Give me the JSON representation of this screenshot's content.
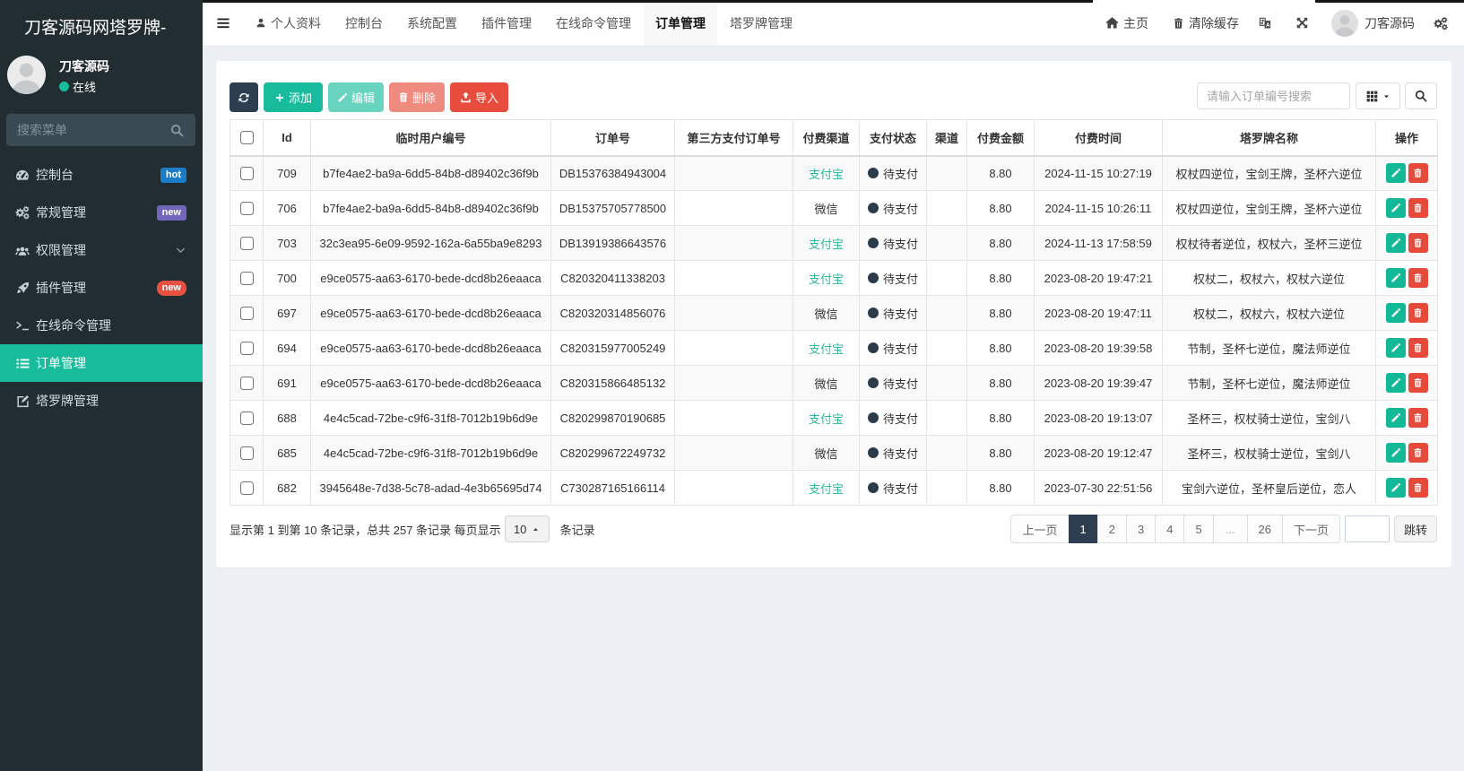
{
  "sidebar": {
    "logo": "刀客源码网塔罗牌-",
    "user": {
      "name": "刀客源码",
      "status": "在线"
    },
    "search_placeholder": "搜索菜单",
    "menu": [
      {
        "label": "控制台",
        "icon": "tachometer-icon",
        "badge": "hot",
        "badge_color": "#1b7cc8",
        "badge_shape": "rect"
      },
      {
        "label": "常规管理",
        "icon": "cogs-icon",
        "badge": "new",
        "badge_color": "#7266ba",
        "badge_shape": "rect"
      },
      {
        "label": "权限管理",
        "icon": "users-icon",
        "chevron": true
      },
      {
        "label": "插件管理",
        "icon": "rocket-icon",
        "badge": "new",
        "badge_color": "#e8503f",
        "badge_shape": "pill"
      },
      {
        "label": "在线命令管理",
        "icon": "terminal-icon"
      },
      {
        "label": "订单管理",
        "icon": "list-icon",
        "active": true
      },
      {
        "label": "塔罗牌管理",
        "icon": "file-edit-icon"
      }
    ]
  },
  "topnav": {
    "tabs": [
      {
        "label": "个人资料",
        "icon": "user-icon"
      },
      {
        "label": "控制台"
      },
      {
        "label": "系统配置"
      },
      {
        "label": "插件管理"
      },
      {
        "label": "在线命令管理"
      },
      {
        "label": "订单管理",
        "active": true
      },
      {
        "label": "塔罗牌管理"
      }
    ],
    "right": {
      "home_label": "主页",
      "clear_cache_label": "清除缓存",
      "username": "刀客源码"
    }
  },
  "toolbar": {
    "add_label": "添加",
    "edit_label": "编辑",
    "delete_label": "删除",
    "import_label": "导入",
    "search_placeholder": "请输入订单编号搜索"
  },
  "table": {
    "columns": [
      "Id",
      "临时用户编号",
      "订单号",
      "第三方支付订单号",
      "付费渠道",
      "支付状态",
      "渠道",
      "付费金额",
      "付费时间",
      "塔罗牌名称",
      "操作"
    ],
    "rows": [
      {
        "id": "709",
        "user_no": "b7fe4ae2-ba9a-6dd5-84b8-d89402c36f9b",
        "order_no": "DB15376384943004",
        "third_no": "",
        "pay_channel": "支付宝",
        "pay_status": "待支付",
        "channel": "",
        "amount": "8.80",
        "pay_time": "2024-11-15 10:27:19",
        "tarot": "权杖四逆位，宝剑王牌，圣杯六逆位"
      },
      {
        "id": "706",
        "user_no": "b7fe4ae2-ba9a-6dd5-84b8-d89402c36f9b",
        "order_no": "DB15375705778500",
        "third_no": "",
        "pay_channel": "微信",
        "pay_status": "待支付",
        "channel": "",
        "amount": "8.80",
        "pay_time": "2024-11-15 10:26:11",
        "tarot": "权杖四逆位，宝剑王牌，圣杯六逆位"
      },
      {
        "id": "703",
        "user_no": "32c3ea95-6e09-9592-162a-6a55ba9e8293",
        "order_no": "DB13919386643576",
        "third_no": "",
        "pay_channel": "支付宝",
        "pay_status": "待支付",
        "channel": "",
        "amount": "8.80",
        "pay_time": "2024-11-13 17:58:59",
        "tarot": "权杖待者逆位，权杖六，圣杯三逆位"
      },
      {
        "id": "700",
        "user_no": "e9ce0575-aa63-6170-bede-dcd8b26eaaca",
        "order_no": "C820320411338203",
        "third_no": "",
        "pay_channel": "支付宝",
        "pay_status": "待支付",
        "channel": "",
        "amount": "8.80",
        "pay_time": "2023-08-20 19:47:21",
        "tarot": "权杖二，权杖六，权杖六逆位"
      },
      {
        "id": "697",
        "user_no": "e9ce0575-aa63-6170-bede-dcd8b26eaaca",
        "order_no": "C820320314856076",
        "third_no": "",
        "pay_channel": "微信",
        "pay_status": "待支付",
        "channel": "",
        "amount": "8.80",
        "pay_time": "2023-08-20 19:47:11",
        "tarot": "权杖二，权杖六，权杖六逆位"
      },
      {
        "id": "694",
        "user_no": "e9ce0575-aa63-6170-bede-dcd8b26eaaca",
        "order_no": "C820315977005249",
        "third_no": "",
        "pay_channel": "支付宝",
        "pay_status": "待支付",
        "channel": "",
        "amount": "8.80",
        "pay_time": "2023-08-20 19:39:58",
        "tarot": "节制，圣杯七逆位，魔法师逆位"
      },
      {
        "id": "691",
        "user_no": "e9ce0575-aa63-6170-bede-dcd8b26eaaca",
        "order_no": "C820315866485132",
        "third_no": "",
        "pay_channel": "微信",
        "pay_status": "待支付",
        "channel": "",
        "amount": "8.80",
        "pay_time": "2023-08-20 19:39:47",
        "tarot": "节制，圣杯七逆位，魔法师逆位"
      },
      {
        "id": "688",
        "user_no": "4e4c5cad-72be-c9f6-31f8-7012b19b6d9e",
        "order_no": "C820299870190685",
        "third_no": "",
        "pay_channel": "支付宝",
        "pay_status": "待支付",
        "channel": "",
        "amount": "8.80",
        "pay_time": "2023-08-20 19:13:07",
        "tarot": "圣杯三，权杖骑士逆位，宝剑八"
      },
      {
        "id": "685",
        "user_no": "4e4c5cad-72be-c9f6-31f8-7012b19b6d9e",
        "order_no": "C820299672249732",
        "third_no": "",
        "pay_channel": "微信",
        "pay_status": "待支付",
        "channel": "",
        "amount": "8.80",
        "pay_time": "2023-08-20 19:12:47",
        "tarot": "圣杯三，权杖骑士逆位，宝剑八"
      },
      {
        "id": "682",
        "user_no": "3945648e-7d38-5c78-adad-4e3b65695d74",
        "order_no": "C730287165166114",
        "third_no": "",
        "pay_channel": "支付宝",
        "pay_status": "待支付",
        "channel": "",
        "amount": "8.80",
        "pay_time": "2023-07-30 22:51:56",
        "tarot": "宝剑六逆位，圣杯皇后逆位，恋人"
      }
    ]
  },
  "footer": {
    "summary_prefix": "显示第 1 到第 10 条记录，总共 257 条记录 每页显示",
    "page_size": "10",
    "summary_suffix": "条记录",
    "pagination": [
      {
        "label": "上一页",
        "type": "prev"
      },
      {
        "label": "1",
        "type": "num",
        "active": true
      },
      {
        "label": "2",
        "type": "num"
      },
      {
        "label": "3",
        "type": "num"
      },
      {
        "label": "4",
        "type": "num"
      },
      {
        "label": "5",
        "type": "num"
      },
      {
        "label": "...",
        "type": "dots"
      },
      {
        "label": "26",
        "type": "num"
      },
      {
        "label": "下一页",
        "type": "next"
      }
    ],
    "jump_label": "跳转"
  },
  "colors": {
    "accent_teal": "#18bc9c",
    "dark_navy": "#2c3e50",
    "danger_red": "#e74c3c",
    "sidebar_bg": "#222d32",
    "alipay_text": "#29bb9c",
    "status_dot": "#2c3b4a"
  }
}
